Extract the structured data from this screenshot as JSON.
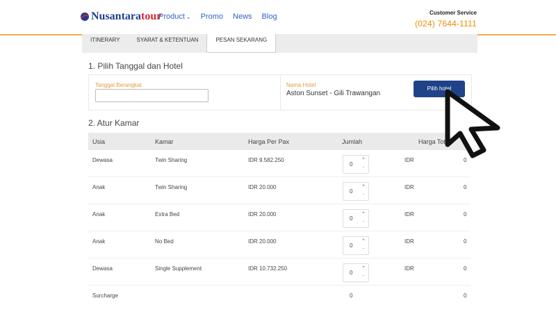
{
  "header": {
    "logo": {
      "part1": "Nusantara",
      "part2": "tour"
    },
    "nav": [
      {
        "label": "Product"
      },
      {
        "label": "Promo"
      },
      {
        "label": "News"
      },
      {
        "label": "Blog"
      }
    ],
    "customer_service": {
      "label": "Customer Service",
      "phone": "(024) 7644-1111"
    }
  },
  "tabs": [
    {
      "label": "ITINERARY",
      "active": false
    },
    {
      "label": "SYARAT & KETENTUAN",
      "active": false
    },
    {
      "label": "PESAN SEKARANG",
      "active": true
    }
  ],
  "section1": {
    "title": "1. Pilih Tanggal dan Hotel",
    "date_label": "Tanggal Berangkat",
    "date_value": "",
    "hotel_label": "Nama Hotel",
    "hotel_name": "Aston Sunset - Gili Trawangan",
    "pilih_button": "Pilih hotel"
  },
  "section2": {
    "title": "2. Atur Kamar",
    "headers": [
      "Usia",
      "Kamar",
      "Harga Per Pax",
      "Jumlah",
      "Harga Total"
    ],
    "rows": [
      {
        "usia": "Dewasa",
        "kamar": "Twin Sharing",
        "harga": "IDR 9.582.250",
        "jumlah": "0",
        "currency": "IDR",
        "total": "0"
      },
      {
        "usia": "Anak",
        "kamar": "Twin Sharing",
        "harga": "IDR 20.000",
        "jumlah": "0",
        "currency": "IDR",
        "total": "0"
      },
      {
        "usia": "Anak",
        "kamar": "Extra Bed",
        "harga": "IDR 20.000",
        "jumlah": "0",
        "currency": "IDR",
        "total": "0"
      },
      {
        "usia": "Anak",
        "kamar": "No Bed",
        "harga": "IDR 20.000",
        "jumlah": "0",
        "currency": "IDR",
        "total": "0"
      },
      {
        "usia": "Dewasa",
        "kamar": "Single Supplement",
        "harga": "IDR 10.732.250",
        "jumlah": "0",
        "currency": "IDR",
        "total": "0"
      }
    ],
    "surcharge": {
      "label": "Surcharge",
      "jumlah": "0",
      "total": "0"
    }
  },
  "stepper_symbols": {
    "up": "+",
    "down": "-"
  },
  "colors": {
    "brand_blue": "#1f4388",
    "accent_orange": "#f08c00",
    "logo_red": "#d6262b"
  }
}
